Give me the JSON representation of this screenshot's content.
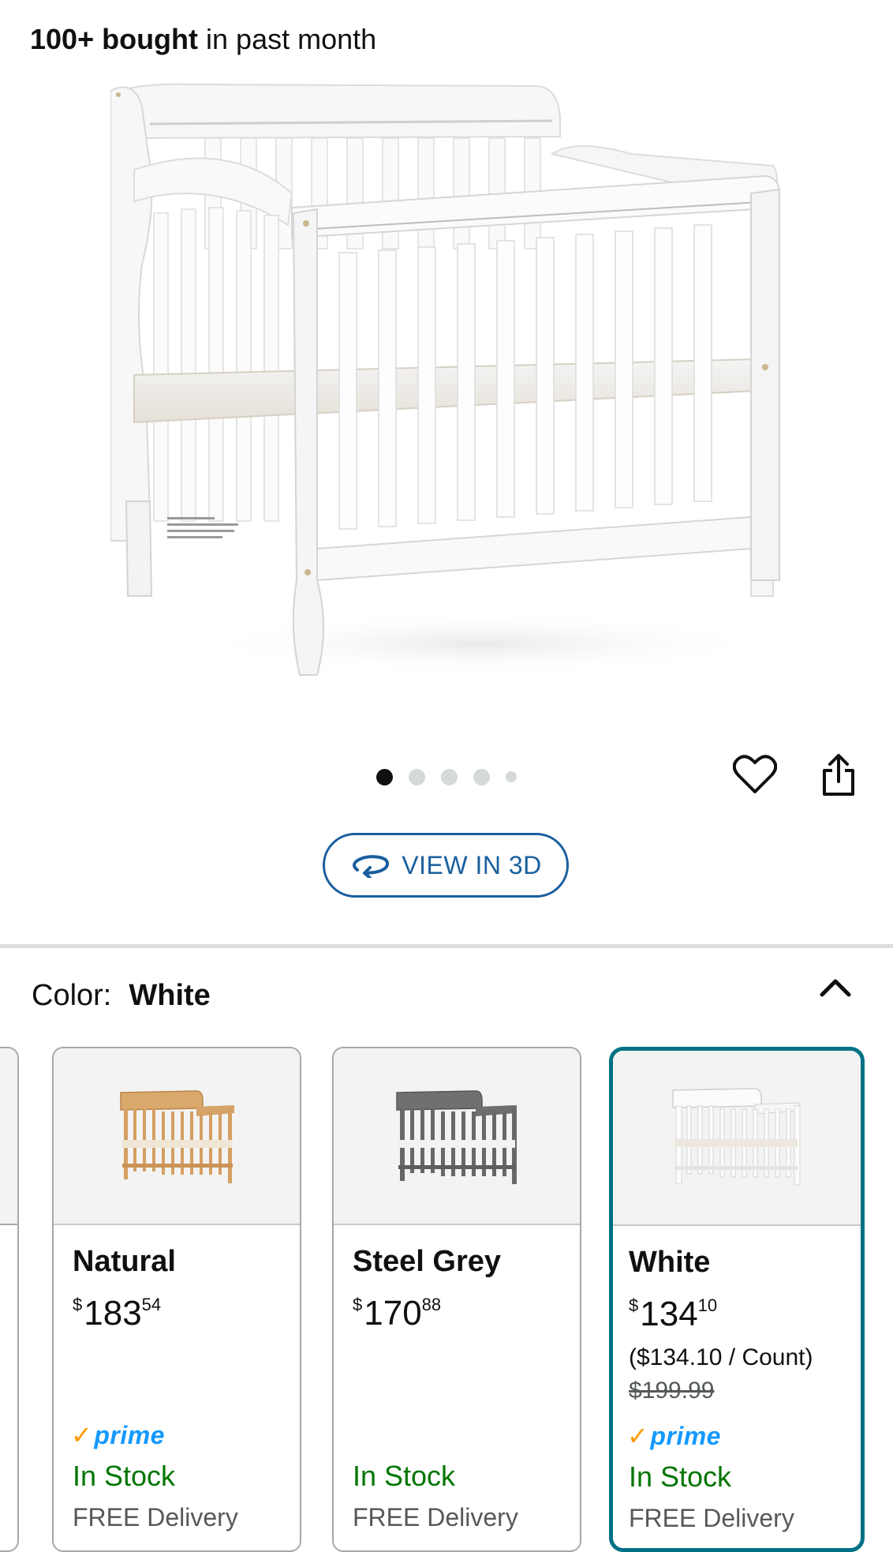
{
  "header": {
    "bought_bold": "100+ bought",
    "bought_rest": " in past month"
  },
  "gallery": {
    "image_name": "white-mini-crib-product-image",
    "dots_total": 5,
    "active_dot": 1
  },
  "actions": {
    "wishlist_icon": "heart-icon",
    "share_icon": "share-icon",
    "view3d_label": "VIEW IN 3D",
    "view3d_icon": "rotate-3d-icon"
  },
  "color_selector": {
    "label": "Color:",
    "value": "White",
    "toggle_icon": "chevron-up-icon",
    "options": [
      {
        "name": "Natural",
        "price_currency": "$",
        "price_whole": "183",
        "price_fraction": "54",
        "unit_price": "",
        "list_price": "",
        "prime": "prime",
        "stock": "In Stock",
        "delivery": "FREE Delivery"
      },
      {
        "name": "Steel Grey",
        "price_currency": "$",
        "price_whole": "170",
        "price_fraction": "88",
        "unit_price": "",
        "list_price": "",
        "prime": "",
        "stock": "In Stock",
        "delivery": "FREE Delivery"
      },
      {
        "name": "White",
        "price_currency": "$",
        "price_whole": "134",
        "price_fraction": "10",
        "unit_price": "($134.10 / Count)",
        "list_price": "$199.99",
        "prime": "prime",
        "stock": "In Stock",
        "delivery": "FREE Delivery"
      }
    ]
  },
  "colors": {
    "link_blue": "#1a5f9e",
    "selected_border": "#007185",
    "in_stock_green": "#007600",
    "prime_blue": "#1399ff",
    "prime_check": "#ff9900"
  }
}
